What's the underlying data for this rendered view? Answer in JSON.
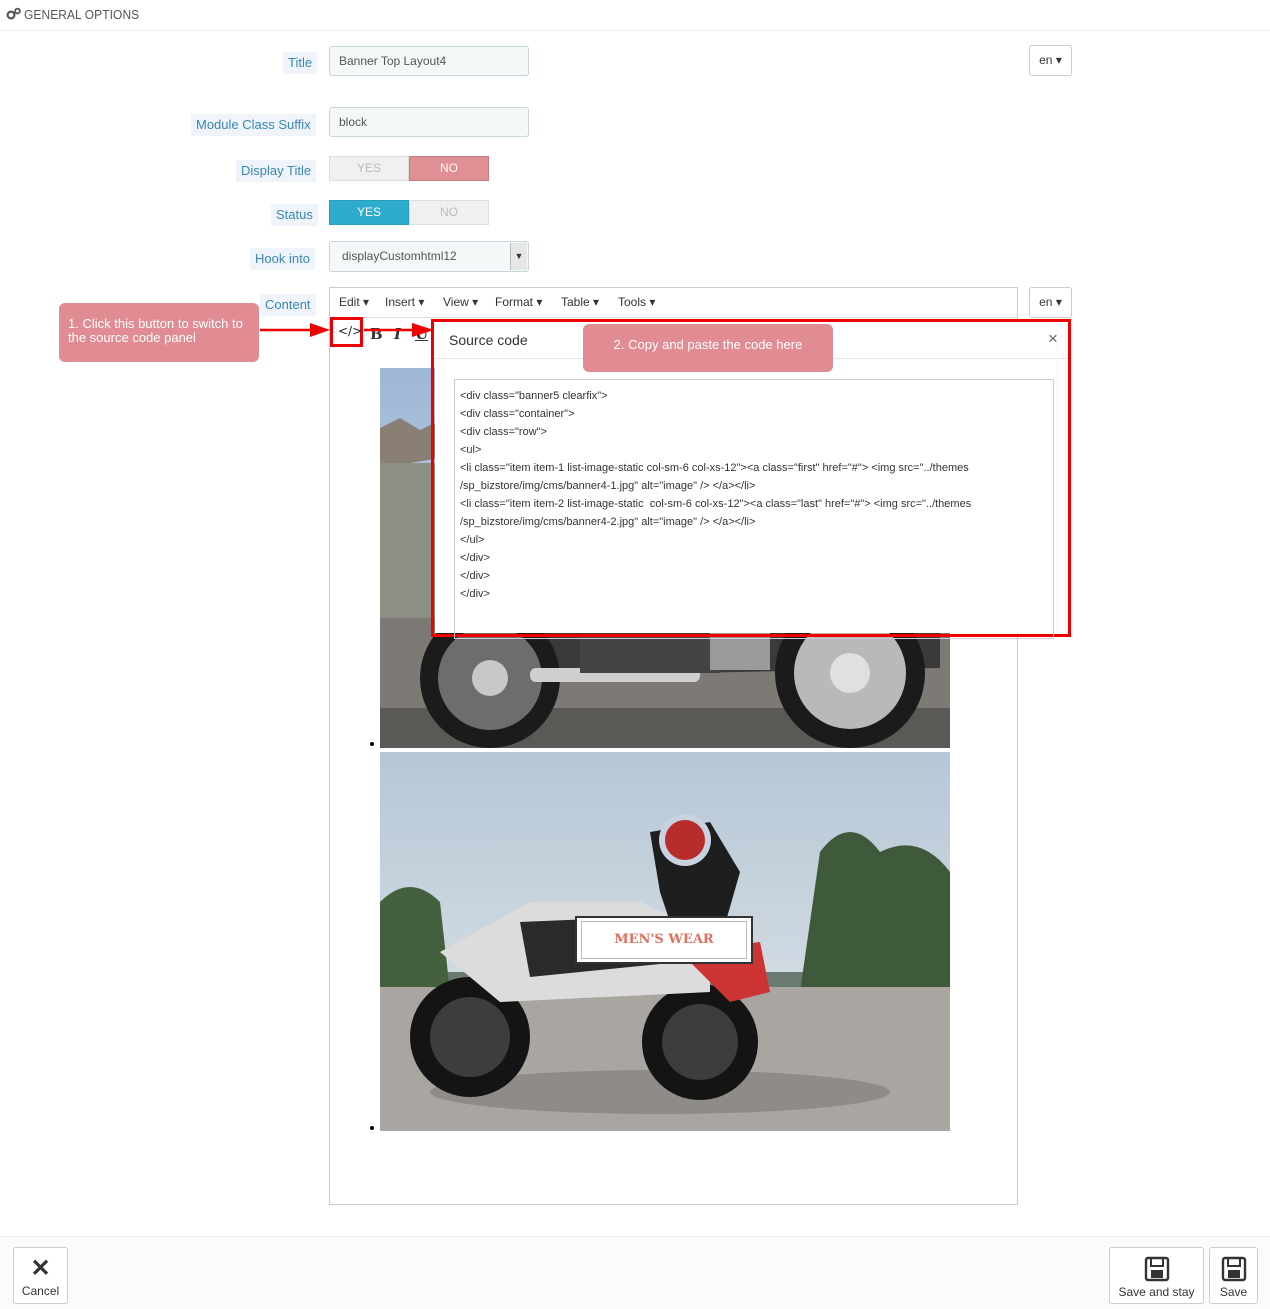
{
  "header": {
    "title": "GENERAL OPTIONS",
    "icon": "gears-icon"
  },
  "form": {
    "title": {
      "label": "Title",
      "value": "Banner Top Layout4",
      "lang": "en"
    },
    "suffix": {
      "label": "Module Class Suffix",
      "value": "block"
    },
    "display_title": {
      "label": "Display Title",
      "yes": "YES",
      "no": "NO",
      "selected": "NO"
    },
    "status": {
      "label": "Status",
      "yes": "YES",
      "no": "NO",
      "selected": "YES"
    },
    "hook": {
      "label": "Hook into",
      "value": "displayCustomhtml12"
    },
    "content": {
      "label": "Content",
      "lang": "en"
    }
  },
  "editor": {
    "menu": [
      "Edit",
      "Insert",
      "View",
      "Format",
      "Table",
      "Tools"
    ],
    "toolbar": {
      "source": "</>",
      "bold": "B",
      "italic": "I",
      "underline": "U"
    }
  },
  "dialog": {
    "title": "Source code",
    "close": "×",
    "code": "<div class=\"banner5 clearfix\">\n<div class=\"container\">\n<div class=\"row\">\n<ul>\n<li class=\"item item-1 list-image-static col-sm-6 col-xs-12\"><a class=\"first\" href=\"#\"> <img src=\"../themes\n/sp_bizstore/img/cms/banner4-1.jpg\" alt=\"image\" /> </a></li>\n<li class=\"item item-2 list-image-static  col-sm-6 col-xs-12\"><a class=\"last\" href=\"#\"> <img src=\"../themes\n/sp_bizstore/img/cms/banner4-2.jpg\" alt=\"image\" /> </a></li>\n</ul>\n</div>\n</div>\n</div>"
  },
  "callouts": {
    "step1": "1. Click this button to switch to the source code panel",
    "step2": "2. Copy and paste the code here"
  },
  "banner": {
    "label": "MEN'S WEAR"
  },
  "footer": {
    "cancel": "Cancel",
    "save_stay": "Save and stay",
    "save": "Save"
  },
  "colors": {
    "accent": "#2eacce",
    "danger": "#e08f95",
    "highlight": "#ee0000",
    "label": "#3b87b3"
  }
}
